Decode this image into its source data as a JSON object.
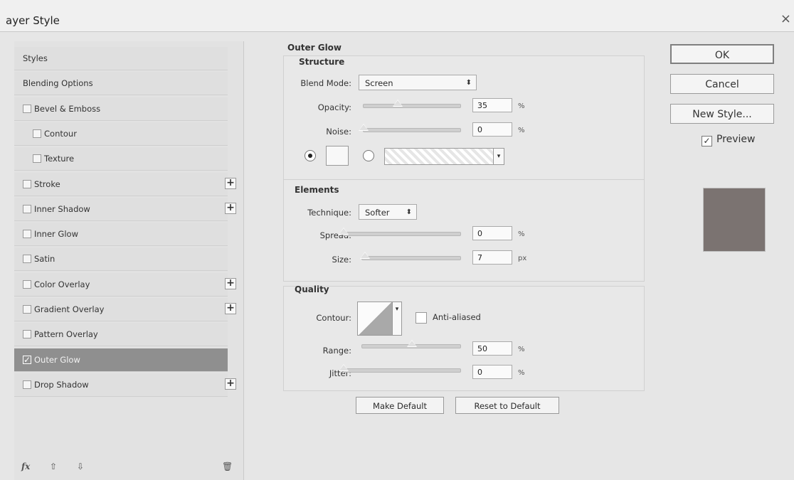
{
  "window": {
    "title": "ayer Style",
    "close_glyph": "×"
  },
  "left_panel": {
    "items": [
      {
        "label": "Styles",
        "checkbox": false,
        "indent": 0,
        "plus": false,
        "checked": false,
        "selected": false
      },
      {
        "label": "Blending Options",
        "checkbox": false,
        "indent": 0,
        "plus": false,
        "checked": false,
        "selected": false
      },
      {
        "label": "Bevel & Emboss",
        "checkbox": true,
        "indent": 0,
        "plus": false,
        "checked": false,
        "selected": false
      },
      {
        "label": "Contour",
        "checkbox": true,
        "indent": 1,
        "plus": false,
        "checked": false,
        "selected": false
      },
      {
        "label": "Texture",
        "checkbox": true,
        "indent": 1,
        "plus": false,
        "checked": false,
        "selected": false
      },
      {
        "label": "Stroke",
        "checkbox": true,
        "indent": 0,
        "plus": true,
        "checked": false,
        "selected": false
      },
      {
        "label": "Inner Shadow",
        "checkbox": true,
        "indent": 0,
        "plus": true,
        "checked": false,
        "selected": false
      },
      {
        "label": "Inner Glow",
        "checkbox": true,
        "indent": 0,
        "plus": false,
        "checked": false,
        "selected": false
      },
      {
        "label": "Satin",
        "checkbox": true,
        "indent": 0,
        "plus": false,
        "checked": false,
        "selected": false
      },
      {
        "label": "Color Overlay",
        "checkbox": true,
        "indent": 0,
        "plus": true,
        "checked": false,
        "selected": false
      },
      {
        "label": "Gradient Overlay",
        "checkbox": true,
        "indent": 0,
        "plus": true,
        "checked": false,
        "selected": false
      },
      {
        "label": "Pattern Overlay",
        "checkbox": true,
        "indent": 0,
        "plus": false,
        "checked": false,
        "selected": false
      },
      {
        "label": "Outer Glow",
        "checkbox": true,
        "indent": 0,
        "plus": false,
        "checked": true,
        "selected": true
      },
      {
        "label": "Drop Shadow",
        "checkbox": true,
        "indent": 0,
        "plus": true,
        "checked": false,
        "selected": false
      }
    ],
    "bottom": {
      "fx": "fx",
      "up_icon": "arrow-up-icon",
      "down_icon": "arrow-down-icon",
      "trash_icon": "trash-icon"
    }
  },
  "outer_glow": {
    "title": "Outer Glow",
    "structure_title": "Structure",
    "blend_mode_label": "Blend Mode:",
    "blend_mode_value": "Screen",
    "opacity_label": "Opacity:",
    "opacity_value": "35",
    "opacity_unit": "%",
    "noise_label": "Noise:",
    "noise_value": "0",
    "noise_unit": "%",
    "elements_title": "Elements",
    "technique_label": "Technique:",
    "technique_value": "Softer",
    "spread_label": "Spread:",
    "spread_value": "0",
    "spread_unit": "%",
    "size_label": "Size:",
    "size_value": "7",
    "size_unit": "px",
    "quality_title": "Quality",
    "contour_label": "Contour:",
    "antialiased_label": "Anti-aliased",
    "range_label": "Range:",
    "range_value": "50",
    "range_unit": "%",
    "jitter_label": "Jitter:",
    "jitter_value": "0",
    "jitter_unit": "%",
    "make_default": "Make Default",
    "reset_default": "Reset to Default"
  },
  "right_panel": {
    "ok": "OK",
    "cancel": "Cancel",
    "new_style": "New Style...",
    "preview_label": "Preview",
    "preview_checked": true,
    "preview_color": "#7b7371"
  }
}
